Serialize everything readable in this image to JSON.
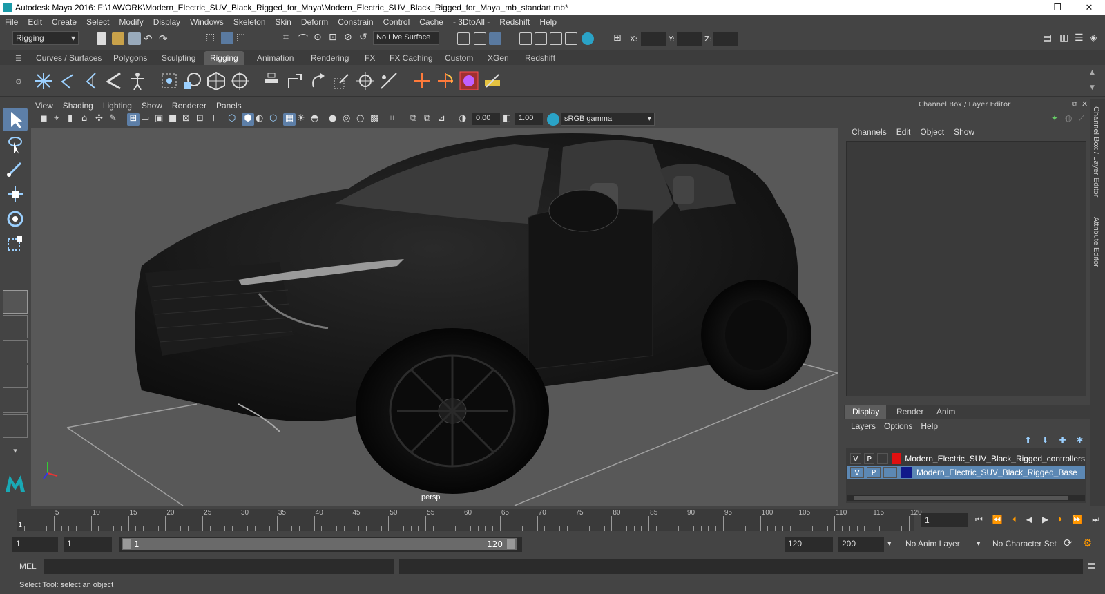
{
  "window": {
    "title": "Autodesk Maya 2016: F:\\1AWORK\\Modern_Electric_SUV_Black_Rigged_for_Maya\\Modern_Electric_SUV_Black_Rigged_for_Maya_mb_standart.mb*",
    "minimize": "—",
    "restore": "❐",
    "close": "✕"
  },
  "menubar": [
    "File",
    "Edit",
    "Create",
    "Select",
    "Modify",
    "Display",
    "Windows",
    "Skeleton",
    "Skin",
    "Deform",
    "Constrain",
    "Control",
    "Cache",
    "- 3DtoAll -",
    "Redshift",
    "Help"
  ],
  "statusline": {
    "menuset": "Rigging",
    "live_surface": "No Live Surface",
    "x_label": "X:",
    "y_label": "Y:",
    "z_label": "Z:"
  },
  "shelf_tabs": [
    "Curves / Surfaces",
    "Polygons",
    "Sculpting",
    "Rigging",
    "Animation",
    "Rendering",
    "FX",
    "FX Caching",
    "Custom",
    "XGen",
    "Redshift"
  ],
  "shelf_active": "Rigging",
  "viewport": {
    "menu": [
      "View",
      "Shading",
      "Lighting",
      "Show",
      "Renderer",
      "Panels"
    ],
    "exposure": "0.00",
    "gamma": "1.00",
    "colorspace": "sRGB gamma",
    "camera": "persp"
  },
  "channelbox": {
    "title": "Channel Box / Layer Editor",
    "menu": [
      "Channels",
      "Edit",
      "Object",
      "Show"
    ]
  },
  "layer_editor": {
    "tabs": [
      "Display",
      "Render",
      "Anim"
    ],
    "active_tab": "Display",
    "menu": [
      "Layers",
      "Options",
      "Help"
    ],
    "layers": [
      {
        "v": "V",
        "p": "P",
        "color": "#e01010",
        "name": "Modern_Electric_SUV_Black_Rigged_controllers",
        "selected": false
      },
      {
        "v": "V",
        "p": "P",
        "color": "#101a8a",
        "name": "Modern_Electric_SUV_Black_Rigged_Base",
        "selected": true
      }
    ]
  },
  "side_tabs": [
    "Channel Box / Layer Editor",
    "Attribute Editor"
  ],
  "timeline": {
    "ticks": [
      "5",
      "10",
      "15",
      "20",
      "25",
      "30",
      "35",
      "40",
      "45",
      "50",
      "55",
      "60",
      "65",
      "70",
      "75",
      "80",
      "85",
      "90",
      "95",
      "100",
      "105",
      "110",
      "115",
      "120"
    ],
    "start_marker": "1",
    "current_frame": "1"
  },
  "range": {
    "start": "1",
    "playback_start": "1",
    "slider_start": "1",
    "slider_end": "120",
    "playback_end": "120",
    "end": "200",
    "anim_layer": "No Anim Layer",
    "character_set": "No Character Set"
  },
  "cmdline": {
    "label": "MEL"
  },
  "helpline": {
    "text": "Select Tool: select an object"
  }
}
